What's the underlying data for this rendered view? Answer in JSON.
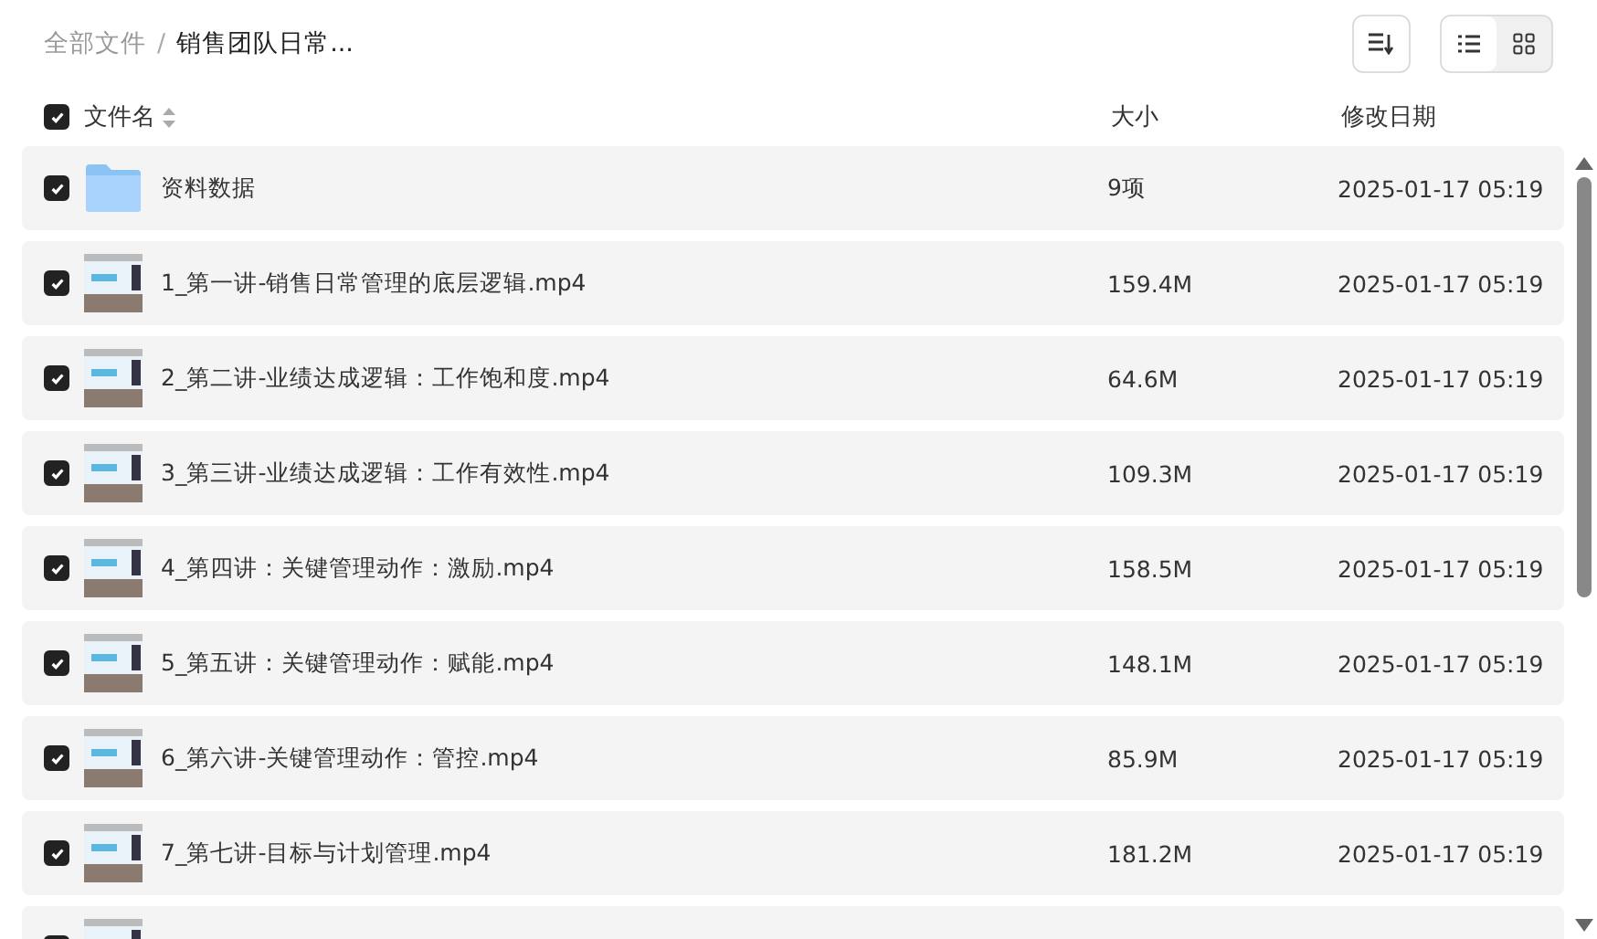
{
  "breadcrumb": [
    {
      "label": "全部文件"
    },
    {
      "separator": "/",
      "label": "销售团队日常..."
    }
  ],
  "view_modes": [
    {
      "kind": "list",
      "selected": true
    },
    {
      "kind": "grid",
      "selected": false
    }
  ],
  "header": {
    "checked": true,
    "columns": [
      "文件名",
      "大小",
      "修改日期"
    ]
  },
  "rows": [
    {
      "kind": "folder",
      "checked": true,
      "name": "资料数据",
      "size": "9项",
      "modified": "2025-01-17 05:19"
    },
    {
      "kind": "video",
      "checked": true,
      "name": "1_第一讲-销售日常管理的底层逻辑.mp4",
      "size": "159.4M",
      "modified": "2025-01-17 05:19"
    },
    {
      "kind": "video",
      "checked": true,
      "name": "2_第二讲-业绩达成逻辑：工作饱和度.mp4",
      "size": "64.6M",
      "modified": "2025-01-17 05:19"
    },
    {
      "kind": "video",
      "checked": true,
      "name": "3_第三讲-业绩达成逻辑：工作有效性.mp4",
      "size": "109.3M",
      "modified": "2025-01-17 05:19"
    },
    {
      "kind": "video",
      "checked": true,
      "name": "4_第四讲：关键管理动作：激励.mp4",
      "size": "158.5M",
      "modified": "2025-01-17 05:19"
    },
    {
      "kind": "video",
      "checked": true,
      "name": "5_第五讲：关键管理动作：赋能.mp4",
      "size": "148.1M",
      "modified": "2025-01-17 05:19"
    },
    {
      "kind": "video",
      "checked": true,
      "name": "6_第六讲-关键管理动作：管控.mp4",
      "size": "85.9M",
      "modified": "2025-01-17 05:19"
    },
    {
      "kind": "video",
      "checked": true,
      "name": "7_第七讲-目标与计划管理.mp4",
      "size": "181.2M",
      "modified": "2025-01-17 05:19"
    },
    {
      "kind": "video",
      "checked": true
    }
  ]
}
